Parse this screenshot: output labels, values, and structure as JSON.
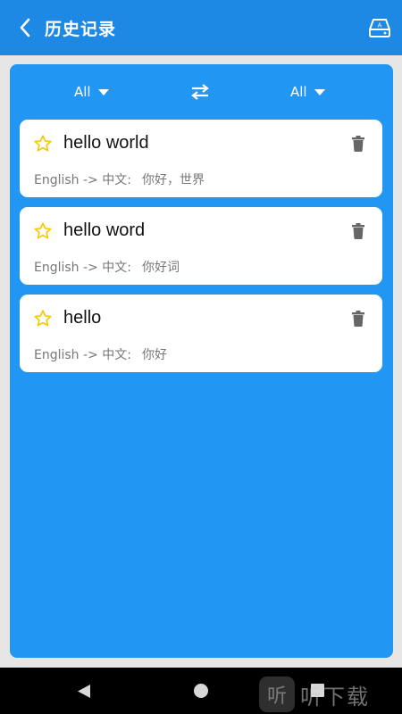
{
  "header": {
    "title": "历史记录",
    "back_icon": "chevron-left-icon",
    "right_icon": "storage-icon"
  },
  "filters": {
    "source_lang": "All",
    "target_lang": "All",
    "swap_icon": "swap-arrows-icon"
  },
  "history": [
    {
      "word": "hello world",
      "direction": "English -> 中文:",
      "translation": "你好，世界",
      "starred": false
    },
    {
      "word": "hello word",
      "direction": "English -> 中文:",
      "translation": "你好词",
      "starred": false
    },
    {
      "word": "hello",
      "direction": "English -> 中文:",
      "translation": "你好",
      "starred": false
    }
  ],
  "watermark": {
    "logo_char": "听",
    "text": "听下载"
  },
  "colors": {
    "header": "#1e88e5",
    "panel": "#2196f3",
    "star": "#f6c800",
    "trash": "#666666"
  }
}
